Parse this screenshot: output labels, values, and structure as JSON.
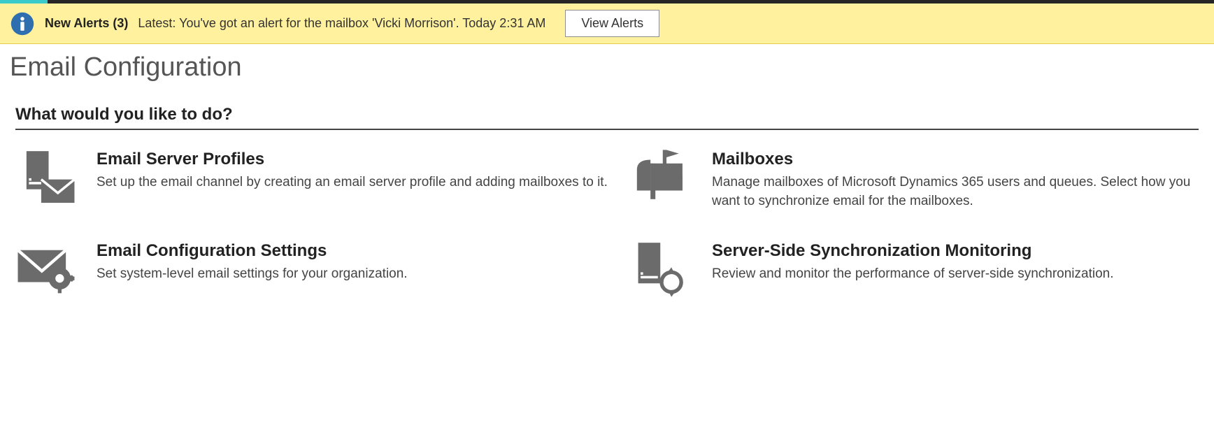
{
  "alert": {
    "title": "New Alerts (3)",
    "latest": "Latest: You've got an alert for the mailbox 'Vicki Morrison'. Today 2:31 AM",
    "button": "View Alerts"
  },
  "page": {
    "title": "Email Configuration",
    "section_heading": "What would you like to do?"
  },
  "tiles": {
    "email_server_profiles": {
      "title": "Email Server Profiles",
      "desc": "Set up the email channel by creating an email server profile and adding mailboxes to it."
    },
    "mailboxes": {
      "title": "Mailboxes",
      "desc": "Manage mailboxes of Microsoft Dynamics 365 users and queues. Select how you want to synchronize email for the mailboxes."
    },
    "email_config_settings": {
      "title": "Email Configuration Settings",
      "desc": "Set system-level email settings for your organization."
    },
    "server_side_sync": {
      "title": "Server-Side Synchronization Monitoring",
      "desc": "Review and monitor the performance of server-side synchronization."
    }
  }
}
